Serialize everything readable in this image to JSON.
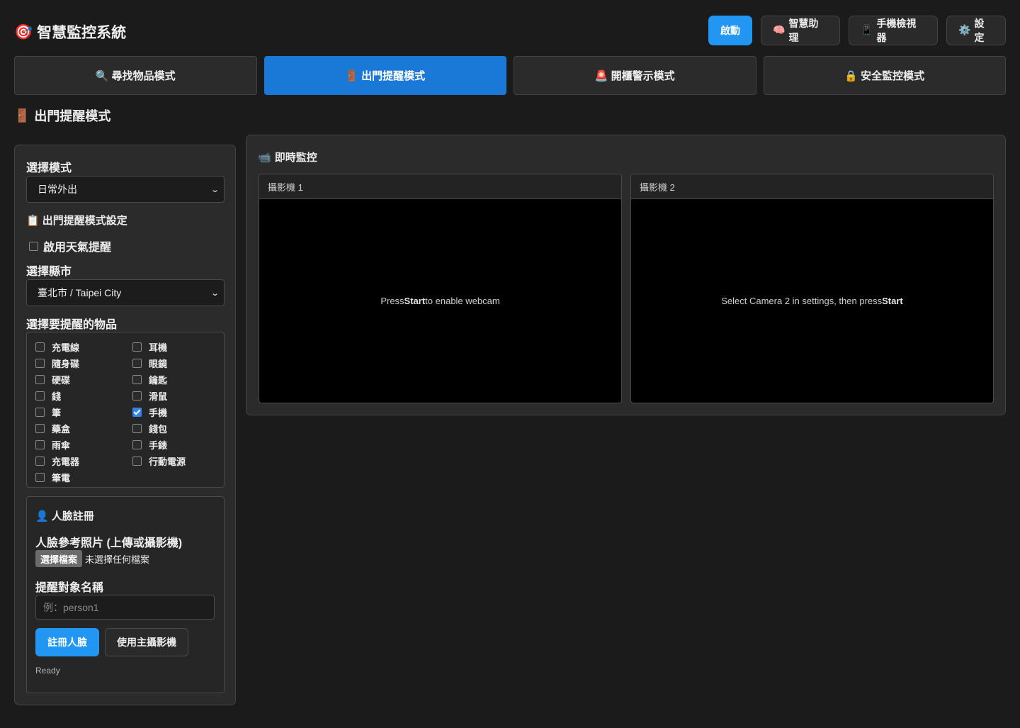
{
  "header": {
    "app_icon": "🎯",
    "app_title": "智慧監控系統",
    "buttons": {
      "start": "啟動",
      "assistant_icon": "🧠",
      "assistant": "智慧助理",
      "mobile_icon": "📱",
      "mobile": "手機檢視器",
      "settings_icon": "⚙️",
      "settings": "設定"
    }
  },
  "tabs": [
    {
      "icon": "🔍",
      "label": "尋找物品模式",
      "active": false
    },
    {
      "icon": "🚪",
      "label": "出門提醒模式",
      "active": true
    },
    {
      "icon": "🚨",
      "label": "開櫃警示模式",
      "active": false
    },
    {
      "icon": "🔒",
      "label": "安全監控模式",
      "active": false
    }
  ],
  "section": {
    "icon": "🚪",
    "title": "出門提醒模式"
  },
  "left": {
    "mode_label": "選擇模式",
    "mode_value": "日常外出",
    "settings_icon": "📋",
    "settings_title": "出門提醒模式設定",
    "weather_label": "啟用天氣提醒",
    "weather_checked": false,
    "city_label": "選擇縣市",
    "city_value": "臺北市 / Taipei City",
    "items_label": "選擇要提醒的物品",
    "items": [
      {
        "label": "充電線",
        "checked": false
      },
      {
        "label": "耳機",
        "checked": false
      },
      {
        "label": "隨身碟",
        "checked": false
      },
      {
        "label": "眼鏡",
        "checked": false
      },
      {
        "label": "硬碟",
        "checked": false
      },
      {
        "label": "鑰匙",
        "checked": false
      },
      {
        "label": "錢",
        "checked": false
      },
      {
        "label": "滑鼠",
        "checked": false
      },
      {
        "label": "筆",
        "checked": false
      },
      {
        "label": "手機",
        "checked": true
      },
      {
        "label": "藥盒",
        "checked": false
      },
      {
        "label": "錢包",
        "checked": false
      },
      {
        "label": "雨傘",
        "checked": false
      },
      {
        "label": "手錶",
        "checked": false
      },
      {
        "label": "充電器",
        "checked": false
      },
      {
        "label": "行動電源",
        "checked": false
      },
      {
        "label": "筆電",
        "checked": false
      }
    ],
    "face": {
      "icon": "👤",
      "title": "人臉註冊",
      "photo_label": "人臉參考照片 (上傳或攝影機)",
      "file_button": "選擇檔案",
      "file_status": "未選擇任何檔案",
      "name_label": "提醒對象名稱",
      "name_placeholder": "例：person1",
      "register_button": "註冊人臉",
      "camera_button": "使用主攝影機",
      "status": "Ready"
    }
  },
  "monitor": {
    "icon": "📹",
    "title": "即時監控",
    "cameras": [
      {
        "label": "攝影機 1",
        "msg_pre": "Press",
        "msg_bold": "Start",
        "msg_post": "to enable webcam"
      },
      {
        "label": "攝影機 2",
        "msg_pre": "Select Camera 2 in settings, then press",
        "msg_bold": "Start",
        "msg_post": ""
      }
    ]
  }
}
